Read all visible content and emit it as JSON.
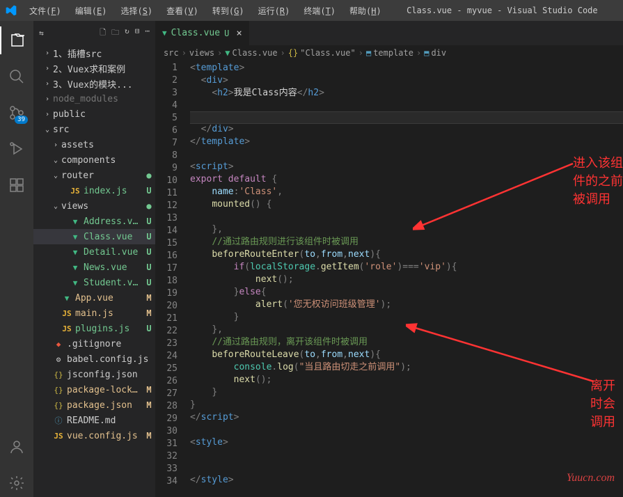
{
  "titlebar": {
    "menus": [
      {
        "label": "文件",
        "key": "F"
      },
      {
        "label": "编辑",
        "key": "E"
      },
      {
        "label": "选择",
        "key": "S"
      },
      {
        "label": "查看",
        "key": "V"
      },
      {
        "label": "转到",
        "key": "G"
      },
      {
        "label": "运行",
        "key": "R"
      },
      {
        "label": "终端",
        "key": "T"
      },
      {
        "label": "帮助",
        "key": "H"
      }
    ],
    "title": "Class.vue - myvue - Visual Studio Code"
  },
  "activitybar": {
    "source_control_badge": "39"
  },
  "sidebar": {
    "tree": [
      {
        "indent": 1,
        "chevron": "›",
        "label": "1、插槽src",
        "type": "folder"
      },
      {
        "indent": 1,
        "chevron": "›",
        "label": "2、Vuex求和案例",
        "type": "folder"
      },
      {
        "indent": 1,
        "chevron": "›",
        "label": "3、Vuex的模块...",
        "type": "folder"
      },
      {
        "indent": 1,
        "chevron": "›",
        "label": "node_modules",
        "type": "folder",
        "dim": true
      },
      {
        "indent": 1,
        "chevron": "›",
        "label": "public",
        "type": "folder"
      },
      {
        "indent": 1,
        "chevron": "⌄",
        "label": "src",
        "type": "folder"
      },
      {
        "indent": 2,
        "chevron": "›",
        "label": "assets",
        "type": "folder"
      },
      {
        "indent": 2,
        "chevron": "⌄",
        "label": "components",
        "type": "folder"
      },
      {
        "indent": 2,
        "chevron": "⌄",
        "label": "router",
        "type": "folder",
        "status": "●",
        "statusClass": "U",
        "ucolor": true
      },
      {
        "indent": 3,
        "icon": "JS",
        "iconClass": "ic-js",
        "label": "index.js",
        "status": "U",
        "statusClass": "U",
        "ucolor": true
      },
      {
        "indent": 2,
        "chevron": "⌄",
        "label": "views",
        "type": "folder",
        "status": "●",
        "statusClass": "U",
        "ucolor": true
      },
      {
        "indent": 3,
        "icon": "▼",
        "iconClass": "ic-vue",
        "label": "Address.vue",
        "status": "U",
        "statusClass": "U",
        "ucolor": true
      },
      {
        "indent": 3,
        "icon": "▼",
        "iconClass": "ic-vue",
        "label": "Class.vue",
        "status": "U",
        "statusClass": "U",
        "ucolor": true,
        "selected": true
      },
      {
        "indent": 3,
        "icon": "▼",
        "iconClass": "ic-vue",
        "label": "Detail.vue",
        "status": "U",
        "statusClass": "U",
        "ucolor": true
      },
      {
        "indent": 3,
        "icon": "▼",
        "iconClass": "ic-vue",
        "label": "News.vue",
        "status": "U",
        "statusClass": "U",
        "ucolor": true
      },
      {
        "indent": 3,
        "icon": "▼",
        "iconClass": "ic-vue",
        "label": "Student.vue",
        "status": "U",
        "statusClass": "U",
        "ucolor": true
      },
      {
        "indent": 2,
        "icon": "▼",
        "iconClass": "ic-vue",
        "label": "App.vue",
        "status": "M",
        "statusClass": "M",
        "mcolor": true
      },
      {
        "indent": 2,
        "icon": "JS",
        "iconClass": "ic-js",
        "label": "main.js",
        "status": "M",
        "statusClass": "M",
        "mcolor": true
      },
      {
        "indent": 2,
        "icon": "JS",
        "iconClass": "ic-js",
        "label": "plugins.js",
        "status": "U",
        "statusClass": "U",
        "ucolor": true
      },
      {
        "indent": 1,
        "icon": "◆",
        "iconClass": "ic-git",
        "label": ".gitignore"
      },
      {
        "indent": 1,
        "icon": "⚙",
        "iconClass": "ic-folder",
        "label": "babel.config.js"
      },
      {
        "indent": 1,
        "icon": "{}",
        "iconClass": "ic-json",
        "label": "jsconfig.json"
      },
      {
        "indent": 1,
        "icon": "{}",
        "iconClass": "ic-json",
        "label": "package-lock.json",
        "status": "M",
        "statusClass": "M",
        "mcolor": true
      },
      {
        "indent": 1,
        "icon": "{}",
        "iconClass": "ic-json",
        "label": "package.json",
        "status": "M",
        "statusClass": "M",
        "mcolor": true
      },
      {
        "indent": 1,
        "icon": "ⓘ",
        "iconClass": "ic-md",
        "label": "README.md"
      },
      {
        "indent": 1,
        "icon": "JS",
        "iconClass": "ic-js",
        "label": "vue.config.js",
        "status": "M",
        "statusClass": "M",
        "mcolor": true
      }
    ]
  },
  "tabs": {
    "active": {
      "label": "Class.vue",
      "status": "U"
    }
  },
  "breadcrumbs": {
    "items": [
      "src",
      "views",
      "Class.vue",
      "\"Class.vue\"",
      "template",
      "div"
    ]
  },
  "code": {
    "lines": 34
  },
  "annotations": {
    "a1": "进入该组件的之前被调用",
    "a2": "离开时会调用"
  },
  "watermark": "Yuucn.com"
}
